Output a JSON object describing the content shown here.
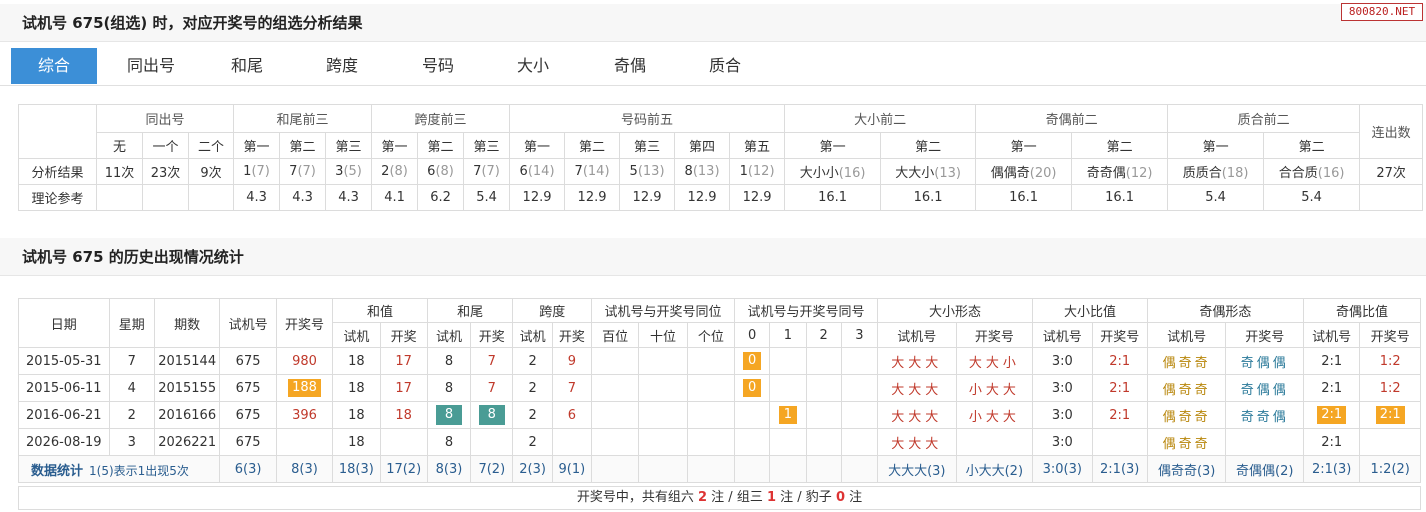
{
  "header1": {
    "title": "试机号 675(组选) 时，对应开奖号的组选分析结果"
  },
  "watermark": "800820.NET",
  "tabs": [
    "综合",
    "同出号",
    "和尾",
    "跨度",
    "号码",
    "大小",
    "奇偶",
    "质合"
  ],
  "analysis": {
    "group_headers": [
      "同出号",
      "和尾前三",
      "跨度前三",
      "号码前五",
      "大小前二",
      "奇偶前二",
      "质合前二",
      "连出数"
    ],
    "sub_headers": [
      "无",
      "一个",
      "二个",
      "第一",
      "第二",
      "第三",
      "第一",
      "第二",
      "第三",
      "第一",
      "第二",
      "第三",
      "第四",
      "第五",
      "第一",
      "第二",
      "第一",
      "第二",
      "第一",
      "第二"
    ],
    "row_labels": [
      "分析结果",
      "理论参考"
    ],
    "results": [
      {
        "v": "11次",
        "p": ""
      },
      {
        "v": "23次",
        "p": ""
      },
      {
        "v": "9次",
        "p": ""
      },
      {
        "v": "1",
        "p": "(7)"
      },
      {
        "v": "7",
        "p": "(7)"
      },
      {
        "v": "3",
        "p": "(5)"
      },
      {
        "v": "2",
        "p": "(8)"
      },
      {
        "v": "6",
        "p": "(8)"
      },
      {
        "v": "7",
        "p": "(7)"
      },
      {
        "v": "6",
        "p": "(14)"
      },
      {
        "v": "7",
        "p": "(14)"
      },
      {
        "v": "5",
        "p": "(13)"
      },
      {
        "v": "8",
        "p": "(13)"
      },
      {
        "v": "1",
        "p": "(12)"
      },
      {
        "v": "大小小",
        "p": "(16)"
      },
      {
        "v": "大大小",
        "p": "(13)"
      },
      {
        "v": "偶偶奇",
        "p": "(20)"
      },
      {
        "v": "奇奇偶",
        "p": "(12)"
      },
      {
        "v": "质质合",
        "p": "(18)"
      },
      {
        "v": "合合质",
        "p": "(16)"
      },
      {
        "v": "27次",
        "p": ""
      }
    ],
    "reference": [
      "",
      "",
      "",
      "4.3",
      "4.3",
      "4.3",
      "4.1",
      "6.2",
      "5.4",
      "12.9",
      "12.9",
      "12.9",
      "12.9",
      "12.9",
      "16.1",
      "16.1",
      "16.1",
      "16.1",
      "5.4",
      "5.4",
      ""
    ]
  },
  "header2": {
    "title": "试机号 675 的历史出现情况统计"
  },
  "history": {
    "h_date": "日期",
    "h_week": "星期",
    "h_issue": "期数",
    "h_test": "试机号",
    "h_open": "开奖号",
    "groups": [
      "和值",
      "和尾",
      "跨度",
      "试机号与开奖号同位",
      "试机号与开奖号同号",
      "大小形态",
      "大小比值",
      "奇偶形态",
      "奇偶比值"
    ],
    "sub": [
      "试机",
      "开奖",
      "试机",
      "开奖",
      "试机",
      "开奖",
      "百位",
      "十位",
      "个位",
      "0",
      "1",
      "2",
      "3",
      "试机号",
      "开奖号",
      "试机号",
      "开奖号",
      "试机号",
      "开奖号",
      "试机号",
      "开奖号"
    ],
    "rows": [
      {
        "date": "2015-05-31",
        "week": "7",
        "issue": "2015144",
        "test": "675",
        "open": "980",
        "sum_t": "18",
        "sum_o": "17",
        "tail_t": "8",
        "tail_o": "7",
        "span_t": "2",
        "span_o": "9",
        "same": "0",
        "dx_t": "大大大",
        "dx_o": "大大小",
        "dxr_t": "3:0",
        "dxr_o": "2:1",
        "jo_t": "偶奇奇",
        "jo_o": "奇偶偶",
        "jor_t": "2:1",
        "jor_o": "1:2"
      },
      {
        "date": "2015-06-11",
        "week": "4",
        "issue": "2015155",
        "test": "675",
        "open": "188",
        "sum_t": "18",
        "sum_o": "17",
        "tail_t": "8",
        "tail_o": "7",
        "span_t": "2",
        "span_o": "7",
        "same": "0",
        "dx_t": "大大大",
        "dx_o": "小大大",
        "dxr_t": "3:0",
        "dxr_o": "2:1",
        "jo_t": "偶奇奇",
        "jo_o": "奇偶偶",
        "jor_t": "2:1",
        "jor_o": "1:2"
      },
      {
        "date": "2016-06-21",
        "week": "2",
        "issue": "2016166",
        "test": "675",
        "open": "396",
        "sum_t": "18",
        "sum_o": "18",
        "tail_t": "8",
        "tail_o": "8",
        "span_t": "2",
        "span_o": "6",
        "same": "1",
        "dx_t": "大大大",
        "dx_o": "小大大",
        "dxr_t": "3:0",
        "dxr_o": "2:1",
        "jo_t": "偶奇奇",
        "jo_o": "奇奇偶",
        "jor_t": "2:1",
        "jor_o": "2:1"
      },
      {
        "date": "2026-08-19",
        "week": "3",
        "issue": "2026221",
        "test": "675",
        "open": "",
        "sum_t": "18",
        "sum_o": "",
        "tail_t": "8",
        "tail_o": "",
        "span_t": "2",
        "span_o": "",
        "same": "",
        "dx_t": "大大大",
        "dx_o": "",
        "dxr_t": "3:0",
        "dxr_o": "",
        "jo_t": "偶奇奇",
        "jo_o": "",
        "jor_t": "2:1",
        "jor_o": ""
      }
    ],
    "stats": {
      "label": "数据统计",
      "note": "1(5)表示1出现5次",
      "cells": [
        "6(3)",
        "8(3)",
        "18(3)",
        "17(2)",
        "8(3)",
        "7(2)",
        "2(3)",
        "9(1)",
        "",
        "",
        "",
        "",
        "",
        "",
        "",
        "大大大(3)",
        "小大大(2)",
        "3:0(3)",
        "2:1(3)",
        "偶奇奇(3)",
        "奇偶偶(2)",
        "2:1(3)",
        "1:2(2)"
      ]
    },
    "summary": {
      "p1": "开奖号中，共有组六 ",
      "n1": "2",
      "p2": " 注 / 组三 ",
      "n2": "1",
      "p3": " 注 / 豹子 ",
      "n3": "0",
      "p4": " 注"
    }
  }
}
